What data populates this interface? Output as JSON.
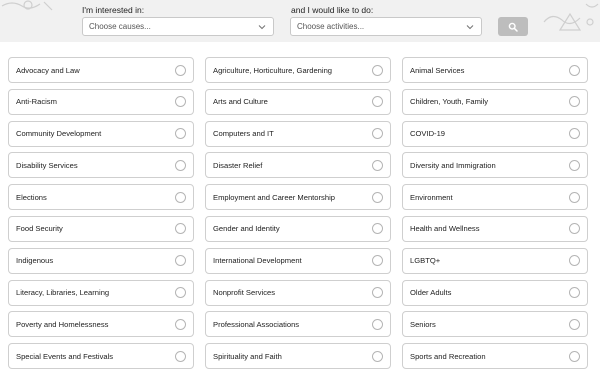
{
  "filters": {
    "causes_label": "I'm interested in:",
    "causes_placeholder": "Choose causes...",
    "activities_label": "and I would like to do:",
    "activities_placeholder": "Choose activities...",
    "search_icon": "search-icon"
  },
  "causes": [
    "Advocacy and Law",
    "Agriculture, Horticulture, Gardening",
    "Animal Services",
    "Anti-Racism",
    "Arts and Culture",
    "Children, Youth, Family",
    "Community Development",
    "Computers and IT",
    "COVID-19",
    "Disability Services",
    "Disaster Relief",
    "Diversity and Immigration",
    "Elections",
    "Employment and Career Mentorship",
    "Environment",
    "Food Security",
    "Gender and Identity",
    "Health and Wellness",
    "Indigenous",
    "International Development",
    "LGBTQ+",
    "Literacy, Libraries, Learning",
    "Nonprofit Services",
    "Older Adults",
    "Poverty and Homelessness",
    "Professional Associations",
    "Seniors",
    "Special Events and Festivals",
    "Spirituality and Faith",
    "Sports and Recreation"
  ],
  "colors": {
    "topbar": "#f1f1f1",
    "search_button": "#bdbdbd",
    "border": "#cfcfcf"
  }
}
